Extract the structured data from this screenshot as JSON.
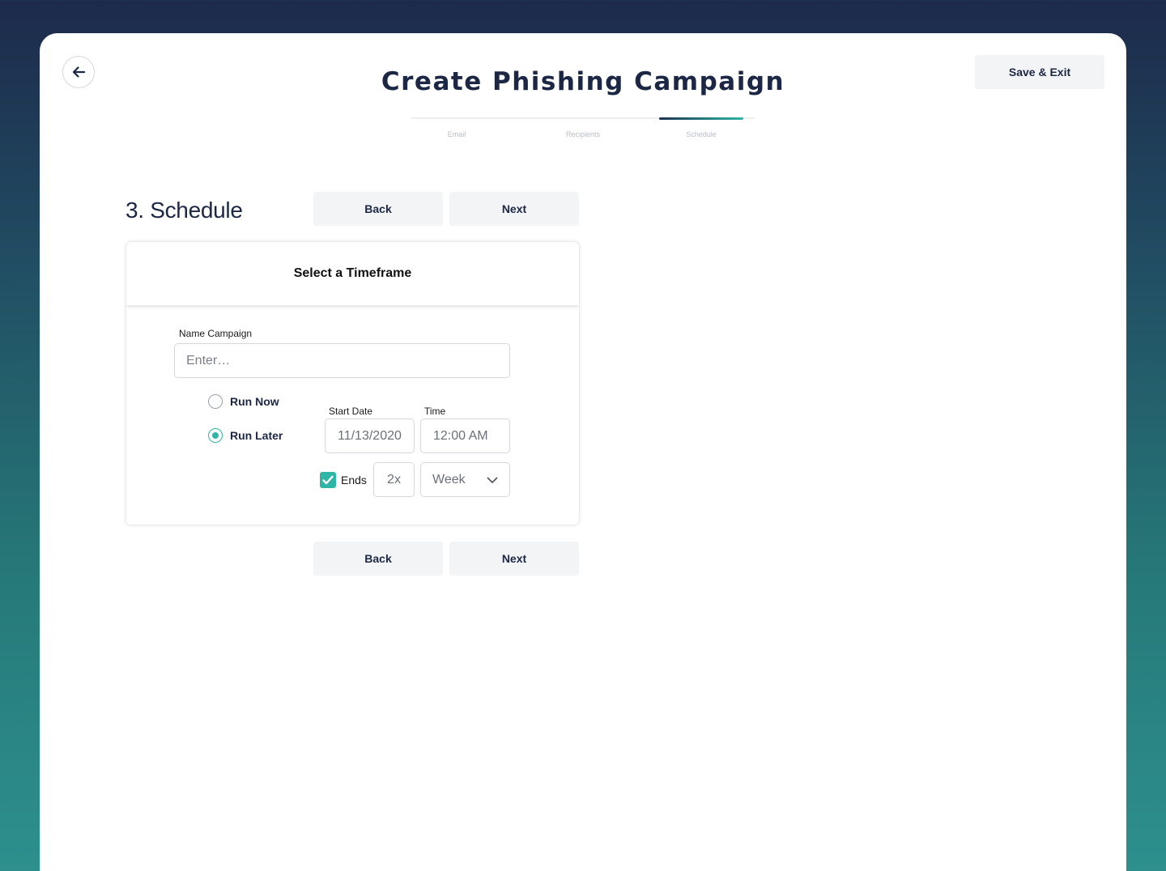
{
  "header": {
    "title": "Create Phishing Campaign",
    "save_exit_label": "Save & Exit",
    "back_icon": "arrow-left-icon"
  },
  "stepper": {
    "steps": [
      {
        "label": "Email",
        "active": false
      },
      {
        "label": "Recipients",
        "active": false
      },
      {
        "label": "Schedule",
        "active": true
      }
    ]
  },
  "section": {
    "heading": "3. Schedule",
    "back_label": "Back",
    "next_label": "Next"
  },
  "panel": {
    "title": "Select a Timeframe",
    "name_label": "Name Campaign",
    "name_placeholder": "Enter…",
    "name_value": "",
    "run_options": [
      {
        "label": "Run Now",
        "selected": false
      },
      {
        "label": "Run Later",
        "selected": true
      }
    ],
    "start_date_label": "Start Date",
    "start_date_value": "11/13/2020",
    "time_label": "Time",
    "time_value": "12:00 AM",
    "ends_checked": true,
    "ends_label": "Ends",
    "frequency_value": "2x",
    "period_value": "Week"
  },
  "colors": {
    "primary_dark": "#1b2744",
    "accent_teal": "#2fb5a5"
  }
}
